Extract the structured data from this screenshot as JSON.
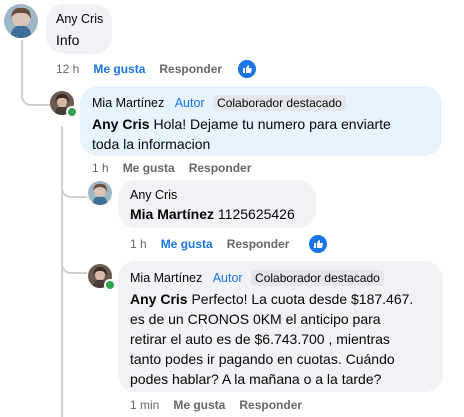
{
  "comments": [
    {
      "author": "Any Cris",
      "text": "Info",
      "time": "12 h",
      "like_label": "Me gusta",
      "reply_label": "Responder"
    },
    {
      "author": "Mia Martínez",
      "role": "Autor",
      "badge": "Colaborador destacado",
      "mention": "Any Cris",
      "text": " Hola! Dejame tu numero para enviarte",
      "text2": "toda la informacion",
      "time": "1 h",
      "like_label": "Me gusta",
      "reply_label": "Responder"
    },
    {
      "author": "Any Cris",
      "mention": "Mia Martínez",
      "text": " 1125625426",
      "time": "1 h",
      "like_label": "Me gusta",
      "reply_label": "Responder"
    },
    {
      "author": "Mia Martínez",
      "role": "Autor",
      "badge": "Colaborador destacado",
      "mention": "Any Cris",
      "lines": [
        " Perfecto! La cuota desde $187.467.",
        "es de un CRONOS 0KM el anticipo para",
        "retirar el auto es de $6.743.700 , mientras",
        "tanto podes ir pagando en cuotas. Cuándo",
        "podes hablar? A la mañana o a la tarde?"
      ],
      "time": "1 min",
      "like_label": "Me gusta",
      "reply_label": "Responder"
    }
  ],
  "colors": {
    "link_blue": "#1b74e4",
    "bubble_gray": "#f0f2f5",
    "bubble_highlight": "#e7f3ff",
    "online_green": "#31a24c"
  }
}
